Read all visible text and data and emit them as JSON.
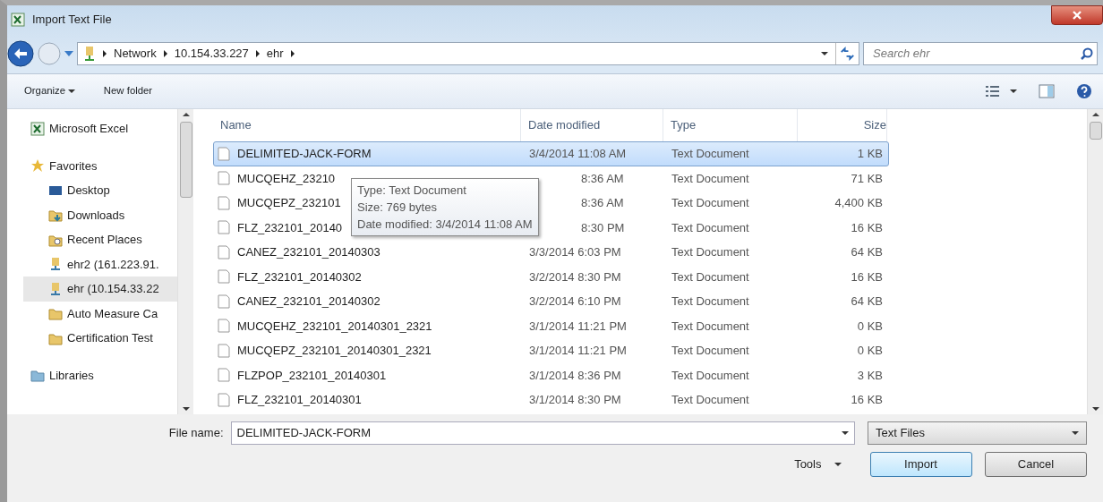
{
  "window": {
    "title": "Import Text File"
  },
  "address": {
    "crumbs": [
      "Network",
      "10.154.33.227",
      "ehr"
    ],
    "search_placeholder": "Search ehr"
  },
  "toolbar": {
    "organize": "Organize",
    "new_folder": "New folder"
  },
  "sidebar": {
    "items": [
      {
        "label": "Microsoft Excel",
        "kind": "app",
        "selected": false
      },
      {
        "label": "Favorites",
        "kind": "favorites",
        "selected": false,
        "children": [
          {
            "label": "Desktop",
            "kind": "desktop",
            "selected": false
          },
          {
            "label": "Downloads",
            "kind": "downloads",
            "selected": false
          },
          {
            "label": "Recent Places",
            "kind": "recent",
            "selected": false
          },
          {
            "label": "ehr2 (161.223.91.",
            "kind": "share",
            "selected": false
          },
          {
            "label": "ehr (10.154.33.22",
            "kind": "share",
            "selected": true
          },
          {
            "label": "Auto Measure Ca",
            "kind": "folder",
            "selected": false
          },
          {
            "label": "Certification Test",
            "kind": "folder",
            "selected": false
          }
        ]
      },
      {
        "label": "Libraries",
        "kind": "libraries",
        "selected": false
      }
    ]
  },
  "table": {
    "columns": [
      "Name",
      "Date modified",
      "Type",
      "Size"
    ],
    "rows": [
      {
        "name": "DELIMITED-JACK-FORM",
        "date": "3/4/2014 11:08 AM",
        "type": "Text Document",
        "size": "1 KB",
        "selected": true,
        "covered": false
      },
      {
        "name": "MUCQEHZ_23210",
        "date": "8:36 AM",
        "type": "Text Document",
        "size": "71 KB",
        "selected": false,
        "covered": true
      },
      {
        "name": "MUCQEPZ_232101",
        "date": "8:36 AM",
        "type": "Text Document",
        "size": "4,400 KB",
        "selected": false,
        "covered": true
      },
      {
        "name": "FLZ_232101_20140",
        "date": "8:30 PM",
        "type": "Text Document",
        "size": "16 KB",
        "selected": false,
        "covered": true
      },
      {
        "name": "CANEZ_232101_20140303",
        "date": "3/3/2014 6:03 PM",
        "type": "Text Document",
        "size": "64 KB",
        "selected": false,
        "covered": false
      },
      {
        "name": "FLZ_232101_20140302",
        "date": "3/2/2014 8:30 PM",
        "type": "Text Document",
        "size": "16 KB",
        "selected": false,
        "covered": false
      },
      {
        "name": "CANEZ_232101_20140302",
        "date": "3/2/2014 6:10 PM",
        "type": "Text Document",
        "size": "64 KB",
        "selected": false,
        "covered": false
      },
      {
        "name": "MUCQEHZ_232101_20140301_2321",
        "date": "3/1/2014 11:21 PM",
        "type": "Text Document",
        "size": "0 KB",
        "selected": false,
        "covered": false
      },
      {
        "name": "MUCQEPZ_232101_20140301_2321",
        "date": "3/1/2014 11:21 PM",
        "type": "Text Document",
        "size": "0 KB",
        "selected": false,
        "covered": false
      },
      {
        "name": "FLZPOP_232101_20140301",
        "date": "3/1/2014 8:36 PM",
        "type": "Text Document",
        "size": "3 KB",
        "selected": false,
        "covered": false
      },
      {
        "name": "FLZ_232101_20140301",
        "date": "3/1/2014 8:30 PM",
        "type": "Text Document",
        "size": "16 KB",
        "selected": false,
        "covered": false
      }
    ]
  },
  "tooltip": {
    "lines": [
      "Type: Text Document",
      "Size: 769 bytes",
      "Date modified: 3/4/2014 11:08 AM"
    ]
  },
  "footer": {
    "file_name_label": "File name:",
    "file_name": "DELIMITED-JACK-FORM",
    "filter": "Text Files",
    "tools": "Tools",
    "import": "Import",
    "cancel": "Cancel"
  }
}
